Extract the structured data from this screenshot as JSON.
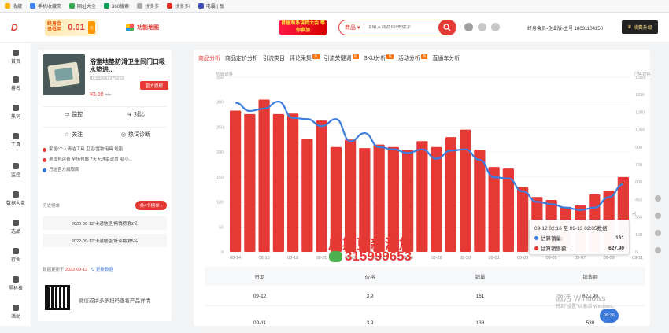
{
  "bookmarks": [
    "收藏",
    "手机收藏夹",
    "网址大全",
    "360搜索",
    "拼多多",
    "拼多多I",
    "电霸 | 品"
  ],
  "header": {
    "promo_text": "终身会员低至",
    "promo_price": "0.01",
    "promo_unit": "元",
    "tool_label": "功能地图",
    "banner_text": "首届淘系讲师大会 等你参加",
    "search_scope": "商品",
    "search_placeholder": "请输入商品ID/关键字",
    "user_text": "终身会员-企业版-主号  18031104150",
    "upgrade_label": "续费升级"
  },
  "sidenav": [
    {
      "label": "首页"
    },
    {
      "label": "排名"
    },
    {
      "label": "热词"
    },
    {
      "label": "工具"
    },
    {
      "label": "监控"
    },
    {
      "label": "数据大盘"
    },
    {
      "label": "选品"
    },
    {
      "label": "行业"
    },
    {
      "label": "黑科技"
    },
    {
      "label": "活动"
    }
  ],
  "product": {
    "title": "浴室地垫防滑卫生间门口吸水垫进...",
    "id": "ID:332062370253",
    "price": "¥3.90",
    "old_price": "¥6.",
    "official_label": "官方旗舰",
    "actions": {
      "monitor": "监控",
      "compare": "对比",
      "follow": "关注",
      "diagnose": "热词诊断"
    },
    "tags": [
      "家居/个人清洁工具 卫浴/置物用具 地垫",
      "退货包运费 全场包邮 7天无理由退货 48小...",
      "巧迹官方旗舰店"
    ],
    "history_label": "历史榜单",
    "history_btn": "共4个榜单",
    "history": [
      "2022-09-12“卡通地垫”畅销榜第3名",
      "2022-09-12“卡通地垫”好评榜第5名"
    ],
    "update_prefix": "数据更新于",
    "update_date": "2022-09-12",
    "update_link": "更新数据",
    "qr_text": "微信或拼多多扫码查看产品详情"
  },
  "tabs": [
    {
      "label": "商品分析",
      "active": true,
      "hot": false
    },
    {
      "label": "商品定价分析",
      "active": false,
      "hot": false
    },
    {
      "label": "引流类目",
      "active": false,
      "hot": false
    },
    {
      "label": "评论采集",
      "active": false,
      "hot": true
    },
    {
      "label": "引流关键词",
      "active": false,
      "hot": true
    },
    {
      "label": "SKU分析",
      "active": false,
      "hot": true
    },
    {
      "label": "活动分析",
      "active": false,
      "hot": true
    },
    {
      "label": "直通车分析",
      "active": false,
      "hot": false
    }
  ],
  "hot_badge": "热",
  "chart_data": {
    "type": "bar",
    "ylabel_left": "估算销量",
    "ylabel_right": "已售销售额",
    "ylim_left": [
      0,
      350
    ],
    "ylim_right": [
      0,
      1500
    ],
    "yticks_left": [
      "0",
      "50",
      "100",
      "150",
      "200",
      "250",
      "300",
      "350"
    ],
    "yticks_right": [
      "0",
      "150",
      "300",
      "450",
      "600",
      "750",
      "900",
      "1050",
      "1200",
      "1350",
      "1500"
    ],
    "x_labels": [
      "08-14",
      "08-16",
      "08-18",
      "08-20",
      "08-22",
      "08-24",
      "08-26",
      "08-28",
      "08-30",
      "09-01",
      "09-03",
      "09-05",
      "09-07",
      "09-09",
      "09-11"
    ],
    "bar_color": "#e53935",
    "line_color": "#3c7de0",
    "series": [
      {
        "name": "估算销量",
        "kind": "bar",
        "values": [
          283,
          276,
          305,
          276,
          277,
          227,
          263,
          210,
          225,
          208,
          215,
          210,
          204,
          222,
          210,
          230,
          245,
          205,
          170,
          167,
          130,
          110,
          104,
          90,
          93,
          115,
          123,
          150
        ]
      },
      {
        "name": "估算销售额",
        "kind": "line",
        "values": [
          1280,
          1210,
          1230,
          1290,
          1150,
          1140,
          1080,
          1140,
          950,
          1020,
          900,
          880,
          850,
          880,
          800,
          870,
          880,
          790,
          640,
          630,
          520,
          430,
          410,
          380,
          360,
          380,
          470,
          580
        ]
      }
    ]
  },
  "tooltip": {
    "title": "09-12 02:16 至 09-13 02:05数据",
    "rows": [
      {
        "label": "估算销量:",
        "value": "161"
      },
      {
        "label": "估算销售额:",
        "value": "627.90"
      }
    ]
  },
  "table": {
    "headers": [
      "日期",
      "价格",
      "销量",
      "销售额"
    ],
    "rows": [
      [
        "09-12",
        "3.9",
        "161",
        "627.90"
      ],
      [
        "09-11",
        "3.9",
        "138",
        "538"
      ]
    ]
  },
  "overlay": {
    "watermark_line1": "后期更新添加",
    "watermark_line2": "315999653",
    "windows_activate": "激活 Windows",
    "windows_hint": "转到\"设置\"以激活 Windows。",
    "floater_label": "06:36"
  }
}
